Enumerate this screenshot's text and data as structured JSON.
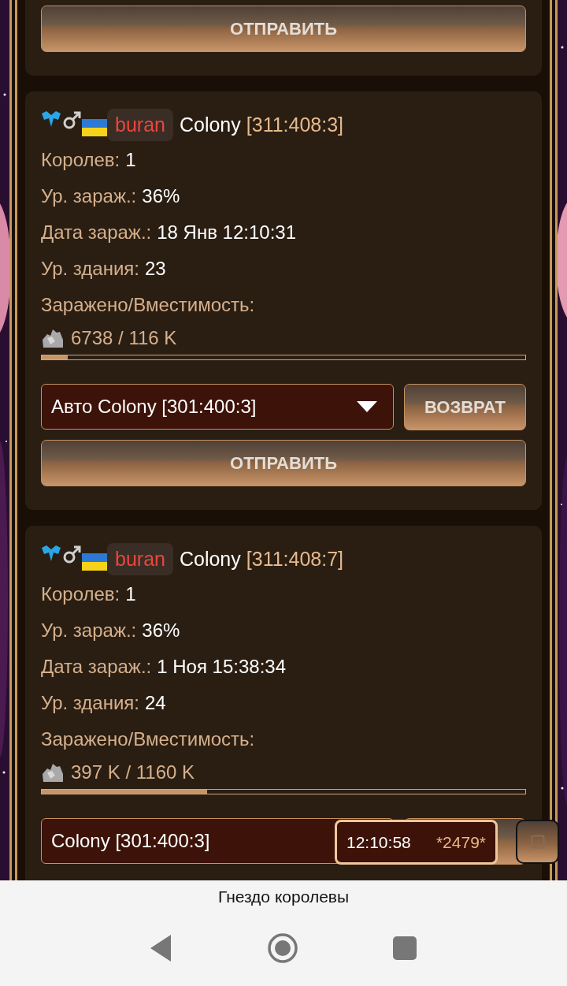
{
  "top_card": {
    "send_button": "ОТПРАВИТЬ"
  },
  "colonies": [
    {
      "player": "buran",
      "name": "Colony",
      "coords": "[311:408:3]",
      "stats": [
        {
          "label": "Королев:",
          "value": "1"
        },
        {
          "label": "Ур. зараж.:",
          "value": "36%"
        },
        {
          "label": "Дата зараж.:",
          "value": "18 Янв 12:10:31"
        },
        {
          "label": "Ур. здания:",
          "value": "23"
        }
      ],
      "capacity_label": "Заражено/Вместимость:",
      "capacity": "6738 / 116 K",
      "level": 0.054,
      "target": "Авто Colony [301:400:3]",
      "return_button": {
        "label": "ВОЗВРАТ"
      },
      "send_button": "ОТПРАВИТЬ"
    },
    {
      "player": "buran",
      "name": "Colony",
      "coords": "[311:408:7]",
      "stats": [
        {
          "label": "Королев:",
          "value": "1"
        },
        {
          "label": "Ур. зараж.:",
          "value": "36%"
        },
        {
          "label": "Дата зараж.:",
          "value": "1 Ноя 15:38:34"
        },
        {
          "label": "Ур. здания:",
          "value": "24"
        }
      ],
      "capacity_label": "Заражено/Вместимость:",
      "capacity": "397 K / 1160 K",
      "level": 0.342,
      "target": "Colony [301:400:3]"
    }
  ],
  "overlay": {
    "time": "12:10:58",
    "code": "*2479*"
  },
  "app_title": "Гнездо королевы"
}
